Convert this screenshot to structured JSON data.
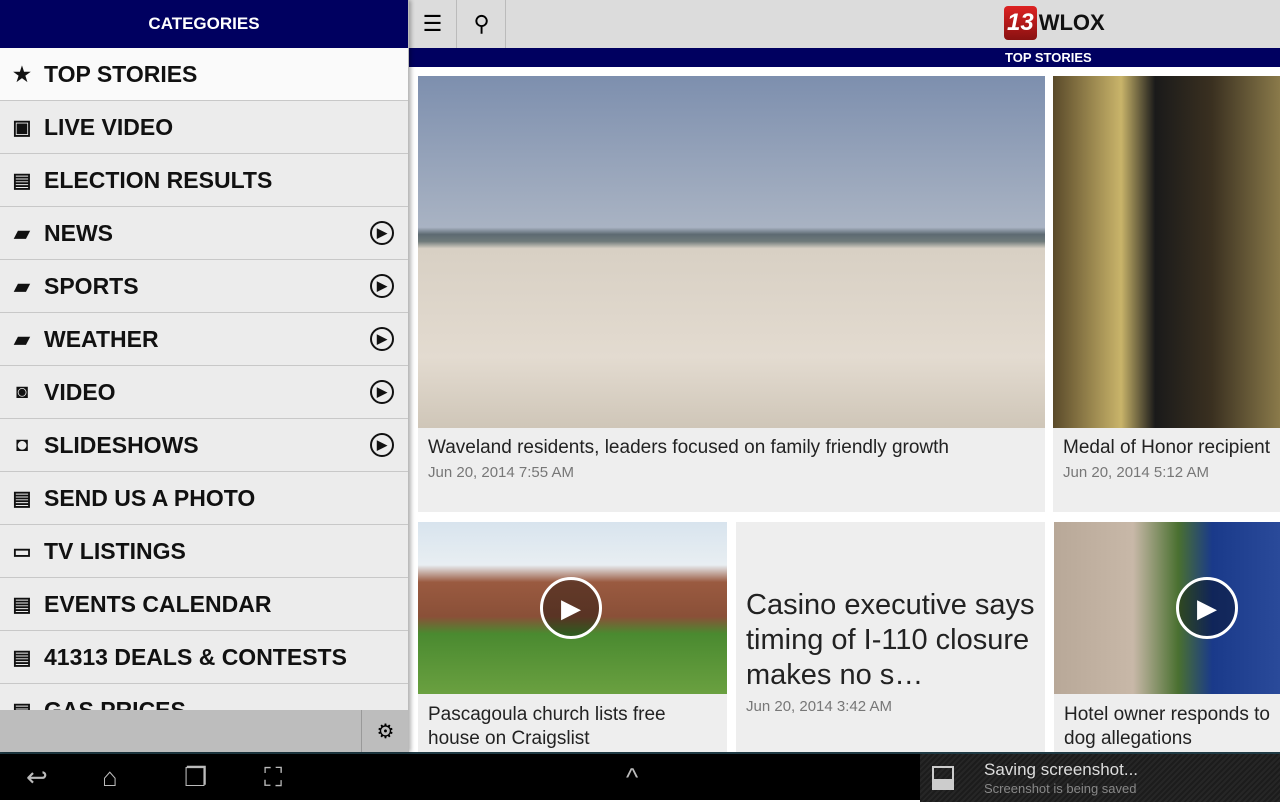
{
  "sidebar": {
    "title": "CATEGORIES",
    "items": [
      {
        "label": "TOP STORIES",
        "icon": "star-icon"
      },
      {
        "label": "LIVE VIDEO",
        "icon": "film-icon"
      },
      {
        "label": "ELECTION RESULTS",
        "icon": "documents-icon"
      },
      {
        "label": "NEWS",
        "icon": "folder-icon",
        "sub": true
      },
      {
        "label": "SPORTS",
        "icon": "folder-icon",
        "sub": true
      },
      {
        "label": "WEATHER",
        "icon": "folder-icon",
        "sub": true
      },
      {
        "label": "VIDEO",
        "icon": "video-camera-icon",
        "sub": true
      },
      {
        "label": "SLIDESHOWS",
        "icon": "camera-icon",
        "sub": true
      },
      {
        "label": "SEND US A PHOTO",
        "icon": "documents-icon"
      },
      {
        "label": "TV LISTINGS",
        "icon": "monitor-icon"
      },
      {
        "label": "EVENTS CALENDAR",
        "icon": "documents-icon"
      },
      {
        "label": "41313 DEALS & CONTESTS",
        "icon": "documents-icon"
      },
      {
        "label": "GAS PRICES",
        "icon": "documents-icon"
      }
    ]
  },
  "header": {
    "logo_number": "13",
    "logo_text": "WLOX",
    "section": "TOP STORIES"
  },
  "stories": [
    {
      "title": "Waveland residents, leaders focused on family friendly growth",
      "date": "Jun 20, 2014 7:55 AM"
    },
    {
      "title": "Medal of Honor recipient",
      "date": "Jun 20, 2014 5:12 AM"
    },
    {
      "title": "Pascagoula church lists free house on Craigslist",
      "video": true
    },
    {
      "title": "Casino executive says timing of I-110 closure makes no s…",
      "date": "Jun 20, 2014 3:42 AM"
    },
    {
      "title": "Hotel owner responds to dog allegations",
      "video": true
    }
  ],
  "notification": {
    "title": "Saving screenshot...",
    "subtitle": "Screenshot is being saved"
  },
  "colors": {
    "brand_navy": "#000060",
    "logo_red": "#cc2222"
  }
}
